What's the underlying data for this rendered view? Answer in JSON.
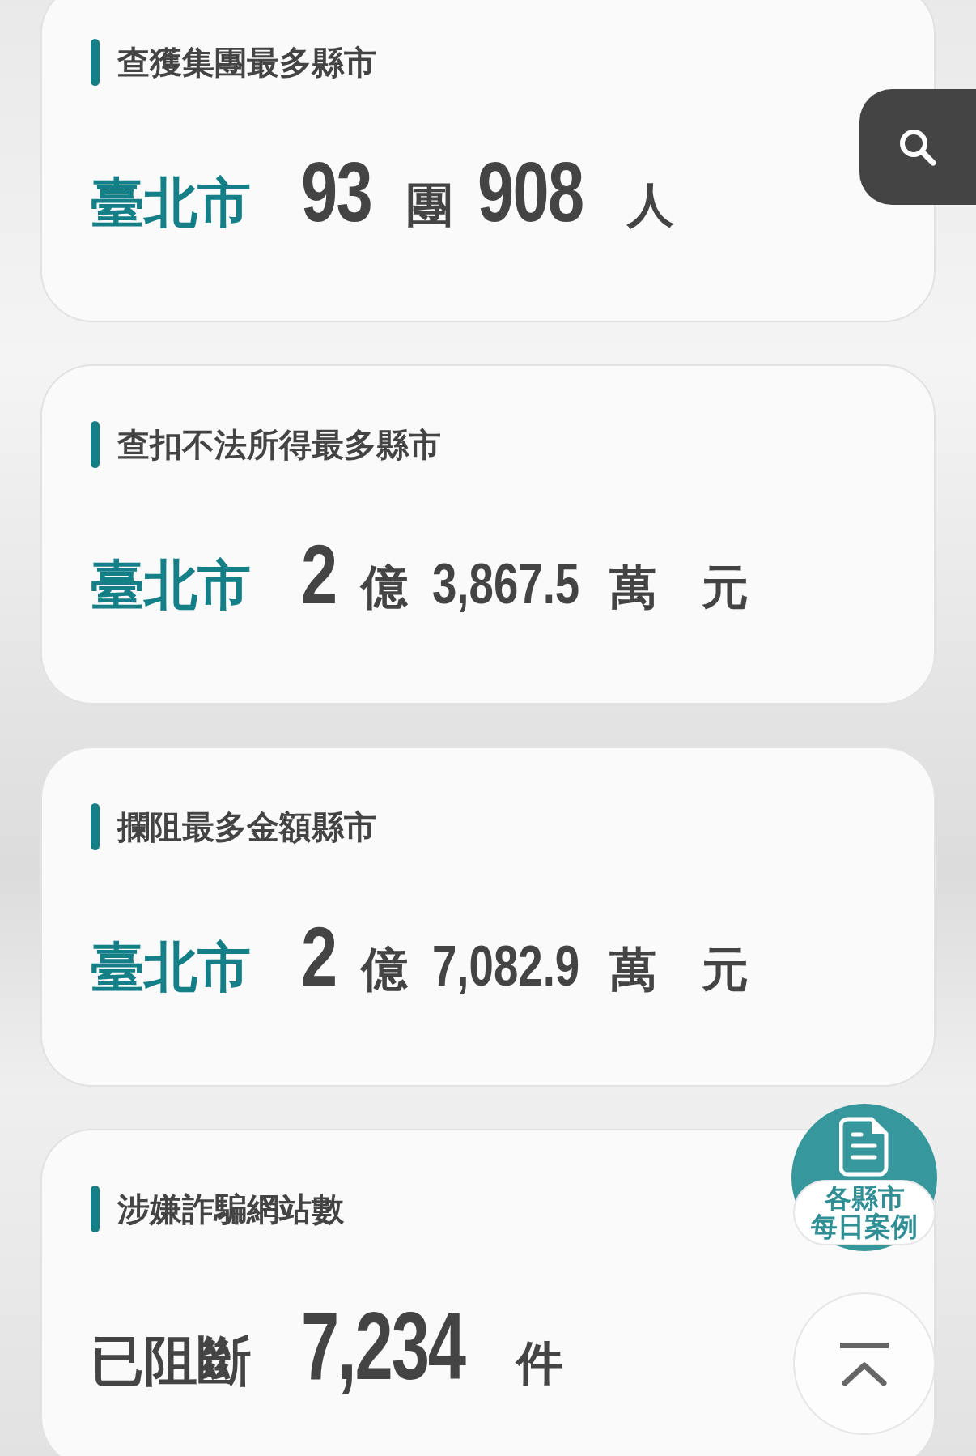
{
  "cards": [
    {
      "title": "查獲集團最多縣市",
      "parts": [
        {
          "kind": "place",
          "text": "臺北市"
        },
        {
          "kind": "number",
          "text": "93"
        },
        {
          "kind": "unit",
          "text": "團"
        },
        {
          "kind": "number",
          "text": "908"
        },
        {
          "kind": "unit",
          "text": "人"
        }
      ]
    },
    {
      "title": "查扣不法所得最多縣市",
      "parts": [
        {
          "kind": "place",
          "text": "臺北市"
        },
        {
          "kind": "number",
          "text": "2"
        },
        {
          "kind": "unit",
          "text": "億"
        },
        {
          "kind": "small_number",
          "text": "3,867.5"
        },
        {
          "kind": "unit",
          "text": "萬"
        },
        {
          "kind": "unit",
          "text": "元"
        }
      ]
    },
    {
      "title": "攔阻最多金額縣市",
      "parts": [
        {
          "kind": "place",
          "text": "臺北市"
        },
        {
          "kind": "number",
          "text": "2"
        },
        {
          "kind": "unit",
          "text": "億"
        },
        {
          "kind": "small_number",
          "text": "7,082.9"
        },
        {
          "kind": "unit",
          "text": "萬"
        },
        {
          "kind": "unit",
          "text": "元"
        }
      ]
    },
    {
      "title": "涉嫌詐騙網站數",
      "parts": [
        {
          "kind": "label",
          "text": "已阻斷"
        },
        {
          "kind": "big_number",
          "text": "7,234"
        },
        {
          "kind": "unit",
          "text": "件"
        }
      ]
    }
  ],
  "daily_cases_button": {
    "label_line_1": "各縣市",
    "label_line_2": "每日案例"
  }
}
